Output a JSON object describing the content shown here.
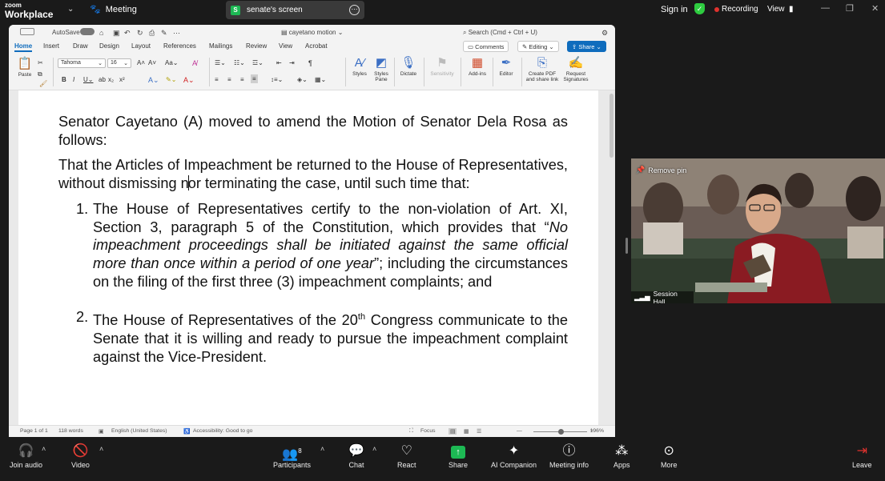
{
  "zoom": {
    "logo_small": "zoom",
    "logo_big": "Workplace",
    "chevron": "⌄",
    "meeting_label": "Meeting",
    "share_pill_badge": "S",
    "share_pill_label": "senate's screen",
    "share_pill_more": "⋯",
    "sign_in": "Sign in",
    "recording": "Recording",
    "view": "View",
    "shield_glyph": "✓"
  },
  "word": {
    "autosave": "AutoSave",
    "doc_title": "cayetano motion",
    "search_placeholder": "Search (Cmd + Ctrl + U)",
    "tabs": [
      "Home",
      "Insert",
      "Draw",
      "Design",
      "Layout",
      "References",
      "Mailings",
      "Review",
      "View",
      "Acrobat"
    ],
    "comments": "Comments",
    "editing": "Editing",
    "share": "Share",
    "paste": "Paste",
    "font_name": "Tahoma",
    "font_size": "16",
    "styles": "Styles",
    "styles_pane": "Styles Pane",
    "dictate": "Dictate",
    "sensitivity": "Sensitivity",
    "add_ins": "Add-ins",
    "editor": "Editor",
    "create_pdf": "Create PDF and share link",
    "request_signatures": "Request Signatures",
    "status": {
      "page": "Page 1 of 1",
      "words": "118 words",
      "language": "English (United States)",
      "accessibility": "Accessibility: Good to go",
      "focus": "Focus",
      "zoom": "196%"
    }
  },
  "document": {
    "para1": "Senator Cayetano (A) moved to amend the Motion of Senator Dela Rosa as follows:",
    "para2_before_cursor": "That the Articles of Impeachment be returned to the House of Representatives, without dismissing n",
    "para2_after_cursor": "or terminating the case, until such time that:",
    "item1_num": "1.",
    "item1_a": "The House of Representatives certify to the non-violation of Art. XI, Section 3, paragraph 5 of the Constitution, which provides that “",
    "item1_italic": "No impeachment proceedings shall be initiated against the same official more than once within a period of one year",
    "item1_b": "”; including the circumstances on the filing of the first three (3) impeachment complaints; and",
    "item2_num": "2.",
    "item2_a": "The House of Representatives of the 20",
    "item2_sup": "th",
    "item2_b": " Congress communicate to the Senate that it is willing and ready to pursue the impeachment complaint against the Vice-President."
  },
  "video": {
    "remove_pin": "Remove pin",
    "participant_name": "Session Hall"
  },
  "bottom": {
    "join_audio": "Join audio",
    "video": "Video",
    "participants": "Participants",
    "participants_count": "8",
    "chat": "Chat",
    "react": "React",
    "share": "Share",
    "ai_companion": "AI Companion",
    "meeting_info": "Meeting info",
    "apps": "Apps",
    "more": "More",
    "leave": "Leave"
  },
  "colors": {
    "word_accent": "#0f6cbd",
    "share_green": "#1db954",
    "record_red": "#e0322e",
    "leave_red": "#e0322e"
  }
}
